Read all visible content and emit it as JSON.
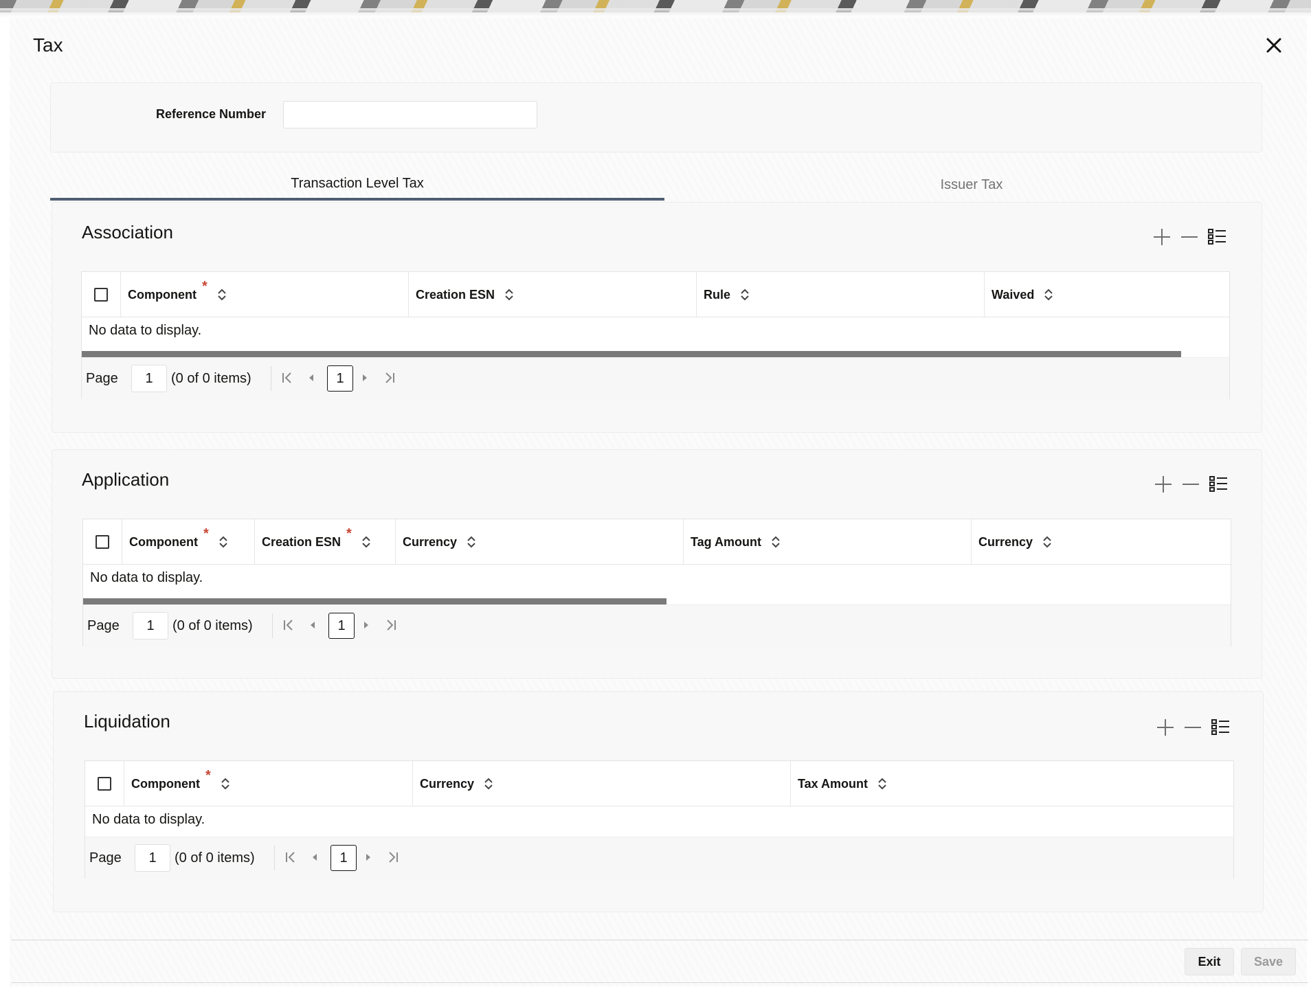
{
  "window": {
    "title": "Tax",
    "close_icon": "close-icon"
  },
  "reference": {
    "label": "Reference Number",
    "value": ""
  },
  "tabs": [
    {
      "label": "Transaction Level Tax",
      "active": true
    },
    {
      "label": "Issuer Tax",
      "active": false
    }
  ],
  "association": {
    "title": "Association",
    "columns": [
      "Component",
      "Creation ESN",
      "Rule",
      "Waived"
    ],
    "required": [
      true,
      false,
      false,
      false
    ],
    "empty_text": "No data to display.",
    "pager": {
      "label": "Page",
      "page": "1",
      "count": "(0 of 0 items)",
      "current": "1"
    }
  },
  "application": {
    "title": "Application",
    "columns": [
      "Component",
      "Creation ESN",
      "Currency",
      "Tag Amount",
      "Currency"
    ],
    "required": [
      true,
      true,
      false,
      false,
      false
    ],
    "empty_text": "No data to display.",
    "pager": {
      "label": "Page",
      "page": "1",
      "count": "(0 of 0 items)",
      "current": "1"
    }
  },
  "liquidation": {
    "title": "Liquidation",
    "columns": [
      "Component",
      "Currency",
      "Tax Amount"
    ],
    "required": [
      true,
      false,
      false
    ],
    "empty_text": "No data to display.",
    "pager": {
      "label": "Page",
      "page": "1",
      "count": "(0 of 0 items)",
      "current": "1"
    }
  },
  "footer": {
    "exit_label": "Exit",
    "save_label": "Save"
  },
  "colors": {
    "accent_tab": "#4f5e72",
    "required": "#c74634"
  }
}
